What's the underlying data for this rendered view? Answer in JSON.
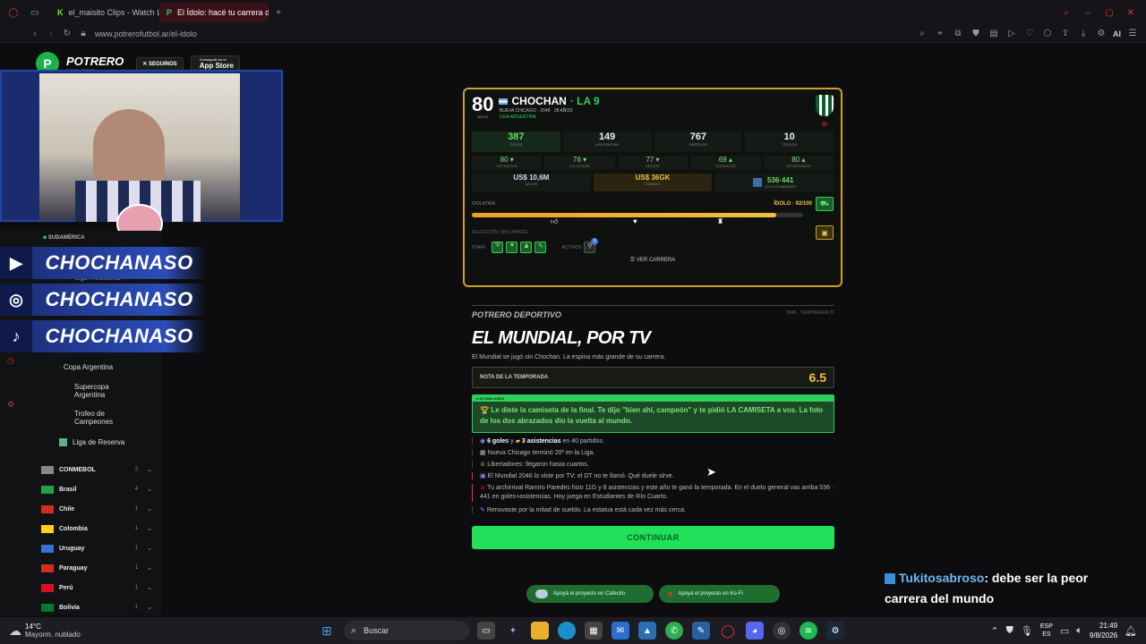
{
  "browser": {
    "tabs": [
      {
        "label": "el_maisito Clips - Watch Li",
        "active": false
      },
      {
        "label": "El Ídolo: hacé tu carrera de",
        "active": true
      }
    ],
    "url": "www.potrerofutbol.ar/el-idolo",
    "toolbar_ai": "AI"
  },
  "site": {
    "brand": "POTRERO",
    "brand_sub": "DATOS · FÚTBOL",
    "follow": "SEGUINOS",
    "appstore_top": "Conseguilo en el",
    "appstore": "App Store"
  },
  "overlay": {
    "region": "SUDAMÉRICA",
    "league_partial": "Liga Profesional",
    "socials": [
      {
        "icon": "youtube-icon",
        "handle": "CHOCHANASO"
      },
      {
        "icon": "instagram-icon",
        "handle": "CHOCHANASO"
      },
      {
        "icon": "tiktok-icon",
        "handle": "CHOCHANASO"
      }
    ]
  },
  "sidebar": {
    "competitions": [
      "Copa Argentina",
      "Supercopa Argentina",
      "Trofeo de Campeones",
      "Liga de Reserva"
    ],
    "regions": [
      {
        "name": "CONMEBOL",
        "count": "2",
        "color": "#888"
      },
      {
        "name": "Brasil",
        "count": "4",
        "color": "#1fa34a"
      },
      {
        "name": "Chile",
        "count": "1",
        "color": "#d52b1e"
      },
      {
        "name": "Colombia",
        "count": "1",
        "color": "#fcd116"
      },
      {
        "name": "Uruguay",
        "count": "1",
        "color": "#3a6fd8"
      },
      {
        "name": "Paraguay",
        "count": "1",
        "color": "#d52b1e"
      },
      {
        "name": "Perú",
        "count": "1",
        "color": "#d91023"
      },
      {
        "name": "Bolivia",
        "count": "1",
        "color": "#007934"
      }
    ]
  },
  "card": {
    "rating": "80",
    "rating_label": "MEDIA",
    "name": "CHOCHAN",
    "nickname": "· LA 9",
    "club_info": "NUEVA CHICAGO · 2048 · 38 AÑOS",
    "league": "LIGA ARGENTINA",
    "stats": [
      {
        "value": "387",
        "label": "GOLES",
        "color": "#5fe05f"
      },
      {
        "value": "149",
        "label": "ASISTENCIAS",
        "color": "#eeeeee"
      },
      {
        "value": "767",
        "label": "PARTIDOS",
        "color": "#eeeeee"
      },
      {
        "value": "10",
        "label": "TÍTULOS",
        "color": "#eeeeee"
      }
    ],
    "attrs": [
      {
        "value": "80 ▾",
        "label": "DEFINICIÓN"
      },
      {
        "value": "76 ▾",
        "label": "VELOCIDAD"
      },
      {
        "value": "77 ▾",
        "label": "REGATE"
      },
      {
        "value": "69 ▴",
        "label": "LIDERAZGO"
      },
      {
        "value": "80 ▴",
        "label": "RESISTENCIA"
      }
    ],
    "value_label": "VALOR",
    "value": "US$ 10,6M",
    "salary_label": "GANADO",
    "salary": "US$ 36GK",
    "versus": "536·441",
    "versus_label": "G+A VS PAREDES",
    "idolatry_label": "IDOLATRÍA",
    "idolo_text": "ÍDOLO · 92/100",
    "idolo_level": 0.92,
    "seleccion": "SELECCIÓN: SIN CHANCE",
    "staff_label": "STAFF",
    "activos_label": "ACTIVOS",
    "activos_count": "5",
    "ver_carrera": "VER CARRERA"
  },
  "article": {
    "kicker": "POTRERO DEPORTIVO",
    "season": "2048 · TEMPORADA 21",
    "headline": "EL MUNDIAL, POR TV",
    "lede": "El Mundial se jugó sin Chochan. La espina más grande de su carrera.",
    "nota_label": "NOTA DE LA TEMPORADA",
    "nota_value": "6.5",
    "breaking_label": "ÚLTIMA HORA",
    "breaking_text": "Le diste la camiseta de la final. Te dijo \"bien ahí, campeón\" y te pidió LA CAMISETA a vos. La foto de los dos abrazados dio la vuelta al mundo.",
    "goals": "6 goles",
    "assists": "3 asistencias",
    "matches": "en 40 partidos.",
    "bullets": [
      "Nueva Chicago terminó 20º en la Liga.",
      "Libertadores: llegaron hasta cuartos.",
      "El Mundial 2046 lo viste por TV: el DT no te llamó. Qué duele sirve.",
      "Tu archirrival Ramiro Paredes hizo 11G y 8 asistencias y este año te ganó la temporada. En el duelo general vas arriba 536 · 441 en goles+asistencias. Hoy juega en Estudiantes de Río Cuarto.",
      "Renovaste por la mitad de sueldo. La estatua está cada vez más cerca."
    ],
    "continue": "CONTINUAR",
    "support1": "Apoyá el proyecto en Cafecito",
    "support2": "Apoyá el proyecto en Ko-Fi"
  },
  "chat": {
    "user": "Tukitosabroso",
    "message": ": debe ser la peor carrera del mundo"
  },
  "taskbar": {
    "weather_temp": "14°C",
    "weather_desc": "Mayorm. nublado",
    "search": "Buscar",
    "lang": "ESP",
    "lang2": "ES",
    "time": "21:49",
    "date": "9/8/2026"
  }
}
